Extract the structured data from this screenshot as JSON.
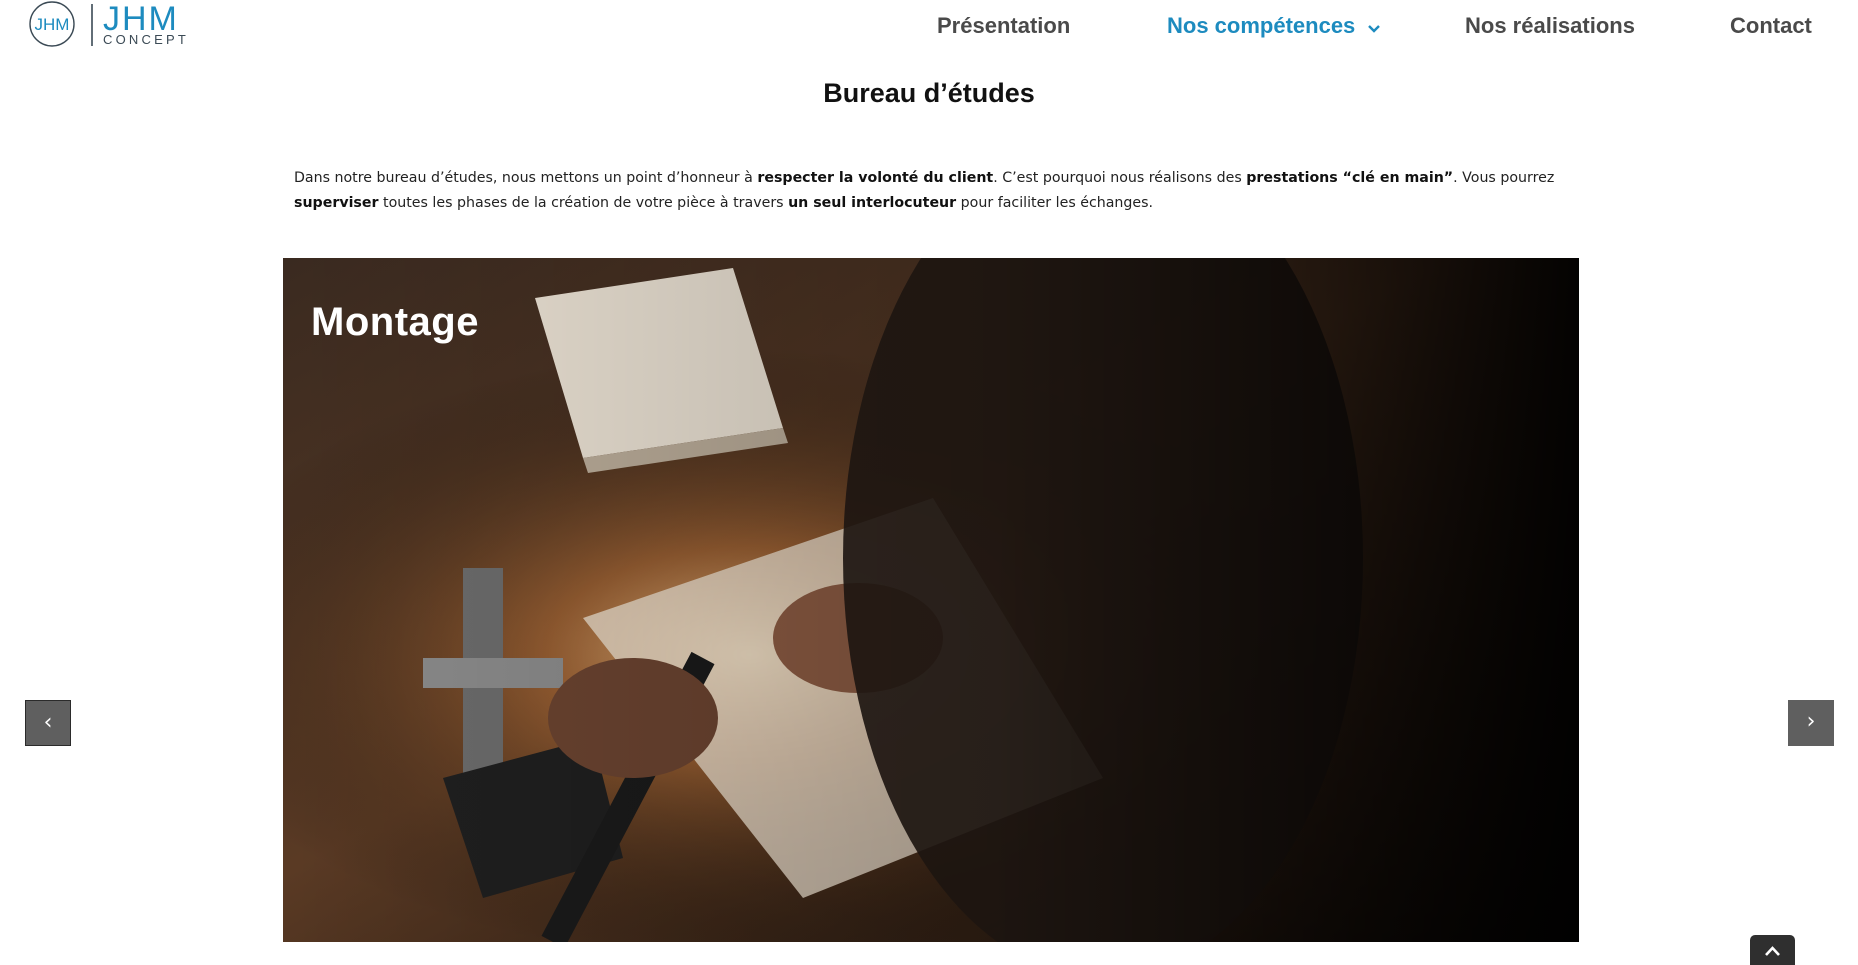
{
  "header": {
    "logo": {
      "mark": "JHM",
      "brand": "JHM",
      "tagline": "CONCEPT"
    },
    "nav": [
      {
        "label": "Présentation",
        "active": false
      },
      {
        "label": "Nos compétences",
        "active": true,
        "has_dropdown": true
      },
      {
        "label": "Nos réalisations",
        "active": false
      },
      {
        "label": "Contact",
        "active": false
      }
    ]
  },
  "content": {
    "title": "Bureau d’études",
    "intro": [
      {
        "text": "Dans notre bureau d’études, nous mettons un point d’honneur à ",
        "bold": false
      },
      {
        "text": "respecter la volonté du client",
        "bold": true
      },
      {
        "text": ". C’est pourquoi nous réalisons des ",
        "bold": false
      },
      {
        "text": "prestations “clé en main”",
        "bold": true
      },
      {
        "text": ". Vous pourrez ",
        "bold": false
      },
      {
        "text": "superviser",
        "bold": true
      },
      {
        "text": " toutes les phases de la création de votre pièce à travers ",
        "bold": false
      },
      {
        "text": "un seul interlocuteur",
        "bold": true
      },
      {
        "text": " pour faciliter les échanges.",
        "bold": false
      }
    ]
  },
  "slider": {
    "slide_title": "Montage",
    "prev_label": "‹",
    "next_label": "›"
  },
  "colors": {
    "accent": "#1d8bbf",
    "nav_text": "#4a4a4a",
    "slider_button": "#5f5f5f",
    "back_to_top": "#2f2f2f"
  },
  "icons": {
    "nav_dropdown": "chevron-down-icon",
    "back_to_top": "chevron-up-icon"
  }
}
